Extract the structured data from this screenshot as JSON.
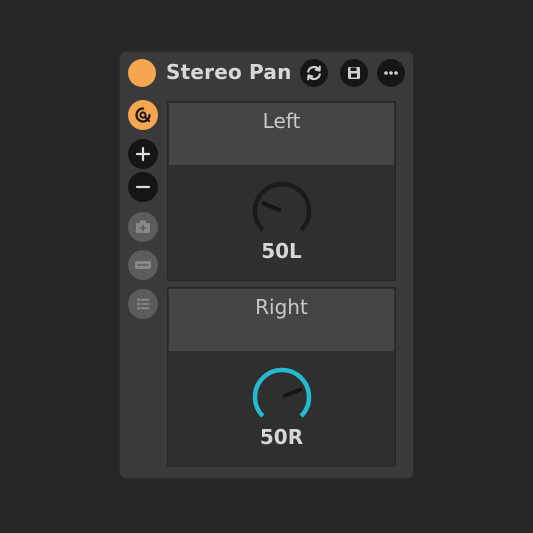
{
  "device": {
    "title": "Stereo Pan",
    "power_on": true,
    "header_buttons": [
      {
        "name": "hot-swap-button",
        "icon": "refresh-icon"
      },
      {
        "name": "save-preset-button",
        "icon": "save-icon"
      },
      {
        "name": "more-options-button",
        "icon": "more-icon"
      }
    ],
    "sidebar_buttons": [
      {
        "name": "mapping-button",
        "icon": "mapping-icon",
        "active": true
      },
      {
        "name": "add-macro-button",
        "icon": "plus-icon"
      },
      {
        "name": "remove-macro-button",
        "icon": "minus-icon"
      },
      {
        "name": "snapshot-button",
        "icon": "camera-icon"
      },
      {
        "name": "randomize-button",
        "icon": "dice-icon"
      },
      {
        "name": "variations-button",
        "icon": "list-icon"
      }
    ]
  },
  "controls": {
    "left": {
      "label": "Left",
      "value": "50L",
      "knob_color": "#1a1a1a",
      "knob_fraction": 0.25
    },
    "right": {
      "label": "Right",
      "value": "50R",
      "knob_color": "#26b9d2",
      "knob_fraction": 0.75
    }
  },
  "colors": {
    "accent": "#f6a650",
    "background": "#272727",
    "device": "#3a3a3a",
    "knob_active": "#26b9d2"
  }
}
